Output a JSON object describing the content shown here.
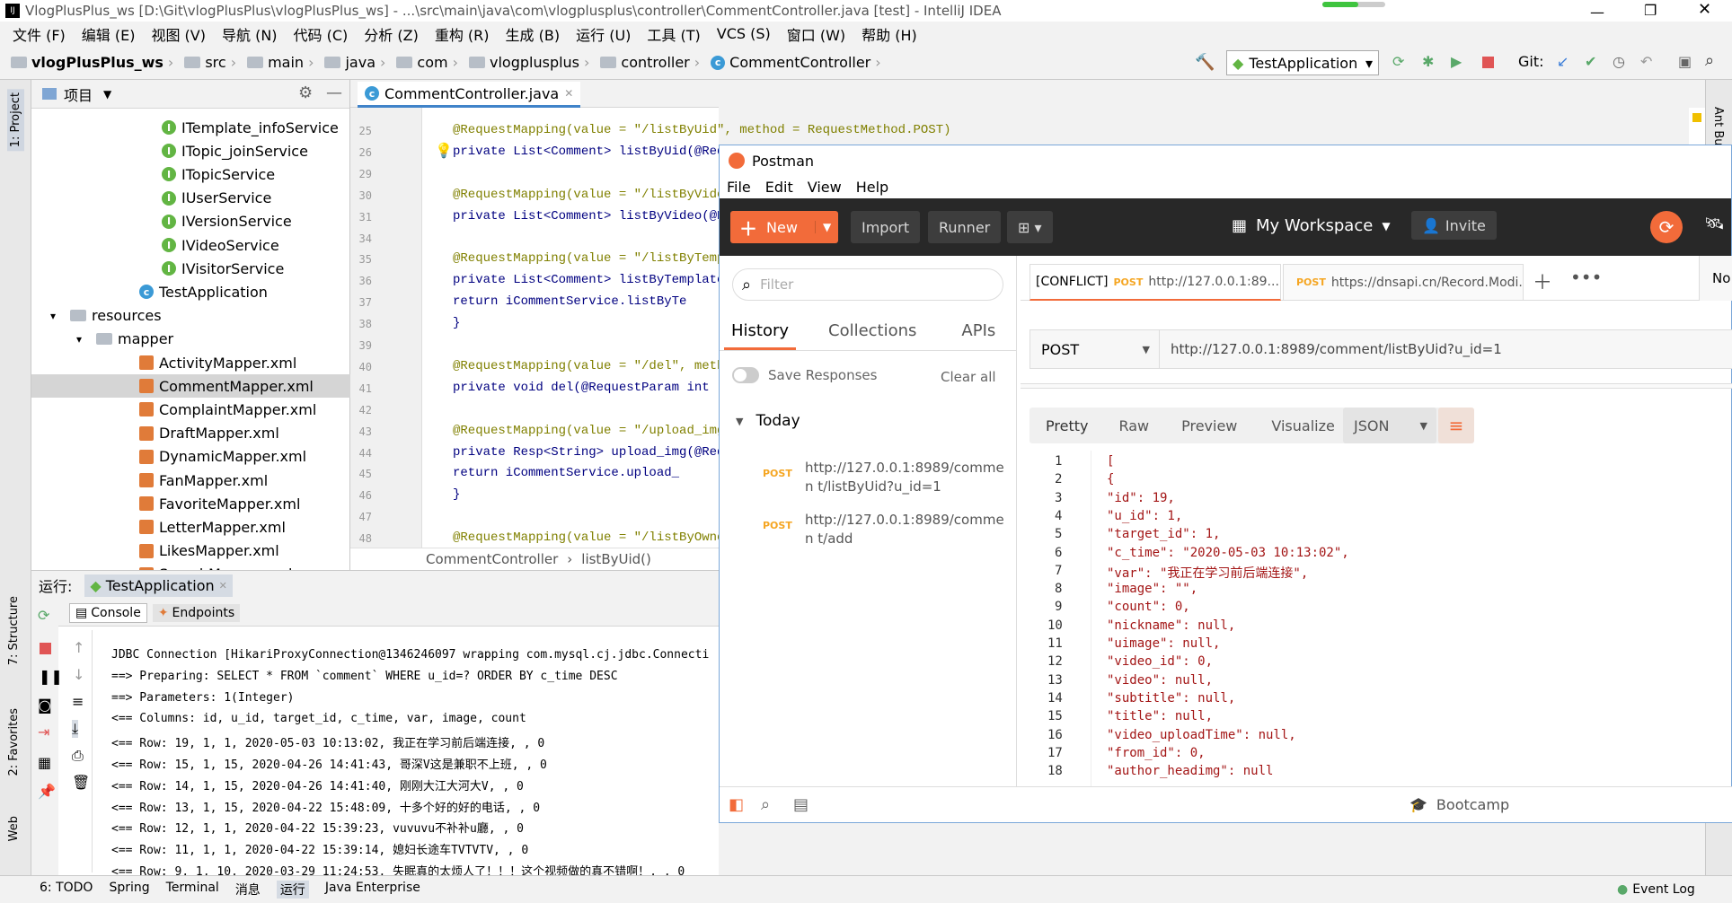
{
  "ide": {
    "window_title": "VlogPlusPlus_ws [D:\\Git\\vlogPlusPlus\\vlogPlusPlus_ws] - ...\\src\\main\\java\\com\\vlogplusplus\\controller\\CommentController.java [test] - IntelliJ IDEA",
    "menu": [
      "文件 (F)",
      "编辑 (E)",
      "视图 (V)",
      "导航 (N)",
      "代码 (C)",
      "分析 (Z)",
      "重构 (R)",
      "生成 (B)",
      "运行 (U)",
      "工具 (T)",
      "VCS (S)",
      "窗口 (W)",
      "帮助 (H)"
    ],
    "breadcrumb": [
      "vlogPlusPlus_ws",
      "src",
      "main",
      "java",
      "com",
      "vlogplusplus",
      "controller",
      "CommentController"
    ],
    "run_config": "TestApplication",
    "git_label": "Git:",
    "project_panel_title": "项目",
    "tree": [
      {
        "label": "ITemplate_infoService",
        "icon": "interface",
        "indent": 0
      },
      {
        "label": "ITopic_joinService",
        "icon": "interface",
        "indent": 0
      },
      {
        "label": "ITopicService",
        "icon": "interface",
        "indent": 0
      },
      {
        "label": "IUserService",
        "icon": "interface",
        "indent": 0
      },
      {
        "label": "IVersionService",
        "icon": "interface",
        "indent": 0
      },
      {
        "label": "IVideoService",
        "icon": "interface",
        "indent": 0
      },
      {
        "label": "IVisitorService",
        "icon": "interface",
        "indent": 0
      },
      {
        "label": "TestApplication",
        "icon": "class",
        "indent": -1
      },
      {
        "label": "resources",
        "icon": "folder",
        "indent": -3
      },
      {
        "label": "mapper",
        "icon": "folder",
        "indent": -2
      },
      {
        "label": "ActivityMapper.xml",
        "icon": "xml",
        "indent": -1
      },
      {
        "label": "CommentMapper.xml",
        "icon": "xml",
        "indent": -1
      },
      {
        "label": "ComplaintMapper.xml",
        "icon": "xml",
        "indent": -1
      },
      {
        "label": "DraftMapper.xml",
        "icon": "xml",
        "indent": -1
      },
      {
        "label": "DynamicMapper.xml",
        "icon": "xml",
        "indent": -1
      },
      {
        "label": "FanMapper.xml",
        "icon": "xml",
        "indent": -1
      },
      {
        "label": "FavoriteMapper.xml",
        "icon": "xml",
        "indent": -1
      },
      {
        "label": "LetterMapper.xml",
        "icon": "xml",
        "indent": -1
      },
      {
        "label": "LikesMapper.xml",
        "icon": "xml",
        "indent": -1
      },
      {
        "label": "SearchMapper.xml",
        "icon": "xml",
        "indent": -1
      }
    ],
    "editor_tab": "CommentController.java",
    "line_numbers": [
      "25",
      "26",
      "29",
      "30",
      "31",
      "34",
      "35",
      "36",
      "37",
      "38",
      "39",
      "40",
      "41",
      "42",
      "43",
      "44",
      "45",
      "46",
      "47",
      "48"
    ],
    "code_lines": [
      "@RequestMapping(value = \"/listByUid\", method = RequestMethod.POST)",
      "private List<Comment> listByUid(@Req",
      "",
      "@RequestMapping(value = \"/listByVide",
      "private List<Comment> listByVideo(@R",
      "",
      "@RequestMapping(value = \"/listByTemp",
      "private List<Comment> listByTemplate",
      "    return iCommentService.listByTe",
      "}",
      "",
      "@RequestMapping(value = \"/del\", meth",
      "private void del(@RequestParam int",
      "",
      "@RequestMapping(value = \"/upload_img",
      "private Resp<String> upload_img(@Req",
      "    return iCommentService.upload_",
      "}",
      "",
      "@RequestMapping(value = \"/listByOwne"
    ],
    "editor_breadcrumb": [
      "CommentController",
      "listByUid()"
    ],
    "run_label": "运行:",
    "run_tab": "TestApplication",
    "console_tabs": [
      "Console",
      "Endpoints"
    ],
    "console_lines": [
      "JDBC Connection [HikariProxyConnection@1346246097 wrapping com.mysql.cj.jdbc.Connecti",
      "==>  Preparing: SELECT * FROM `comment` WHERE u_id=? ORDER BY c_time DESC",
      "==> Parameters: 1(Integer)",
      "<==    Columns: id, u_id, target_id, c_time, var, image, count",
      "<==        Row: 19, 1, 1, 2020-05-03 10:13:02, 我正在学习前后端连接, , 0",
      "<==        Row: 15, 1, 15, 2020-04-26 14:41:43, 哥深V这是兼职不上班, , 0",
      "<==        Row: 14, 1, 15, 2020-04-26 14:41:40, 刚刚大江大河大V, , 0",
      "<==        Row: 13, 1, 15, 2020-04-22 15:48:09, 十多个好的好的电话, , 0",
      "<==        Row: 12, 1, 1, 2020-04-22 15:39:23, vuvuvu不补补u廳, , 0",
      "<==        Row: 11, 1, 1, 2020-04-22 15:39:14, 媳妇长途车TVTVTV, , 0",
      "<==        Row: 9, 1, 10, 2020-03-29 11:24:53, 失眠真的太烦人了！！！这个视频做的真不错啊！, , 0"
    ],
    "bottom_tabs": [
      "6: TODO",
      "Spring",
      "Terminal",
      "消息",
      "运行",
      "Java Enterprise"
    ],
    "event_log": "Event Log",
    "side_tabs": [
      "1: Project",
      "7: Structure",
      "2: Favorites",
      "Web"
    ],
    "right_tab": "Ant Bu"
  },
  "postman": {
    "title": "Postman",
    "menu": [
      "File",
      "Edit",
      "View",
      "Help"
    ],
    "new_label": "New",
    "import_label": "Import",
    "runner_label": "Runner",
    "workspace": "My Workspace",
    "invite": "Invite",
    "filter_placeholder": "Filter",
    "sidebar_tabs": [
      "History",
      "Collections",
      "APIs"
    ],
    "save_responses": "Save Responses",
    "clear_all": "Clear all",
    "today": "Today",
    "history": [
      {
        "method": "POST",
        "url": "http://127.0.0.1:8989/commen t/listByUid?u_id=1"
      },
      {
        "method": "POST",
        "url": "http://127.0.0.1:8989/commen t/add"
      }
    ],
    "request_tabs": [
      {
        "prefix": "[CONFLICT]",
        "method": "POST",
        "url": "http://127.0.0.1:89..."
      },
      {
        "prefix": "",
        "method": "POST",
        "url": "https://dnsapi.cn/Record.Modi..."
      }
    ],
    "env": "No E",
    "method": "POST",
    "url": "http://127.0.0.1:8989/comment/listByUid?u_id=1",
    "response_tabs": [
      "Pretty",
      "Raw",
      "Preview",
      "Visualize"
    ],
    "format": "JSON",
    "json_lines": [
      "[",
      "    {",
      "        \"id\": 19,",
      "        \"u_id\": 1,",
      "        \"target_id\": 1,",
      "        \"c_time\": \"2020-05-03 10:13:02\",",
      "        \"var\": \"我正在学习前后端连接\",",
      "        \"image\": \"\",",
      "        \"count\": 0,",
      "        \"nickname\": null,",
      "        \"uimage\": null,",
      "        \"video_id\": 0,",
      "        \"video\": null,",
      "        \"subtitle\": null,",
      "        \"title\": null,",
      "        \"video_uploadTime\": null,",
      "        \"from_id\": 0,",
      "        \"author_headimg\": null"
    ],
    "json_line_numbers": [
      "1",
      "2",
      "3",
      "4",
      "5",
      "6",
      "7",
      "8",
      "9",
      "10",
      "11",
      "12",
      "13",
      "14",
      "15",
      "16",
      "17",
      "18"
    ],
    "bootcamp": "Bootcamp",
    "colors": {
      "accent": "#f26b3a",
      "dark": "#282828"
    }
  }
}
